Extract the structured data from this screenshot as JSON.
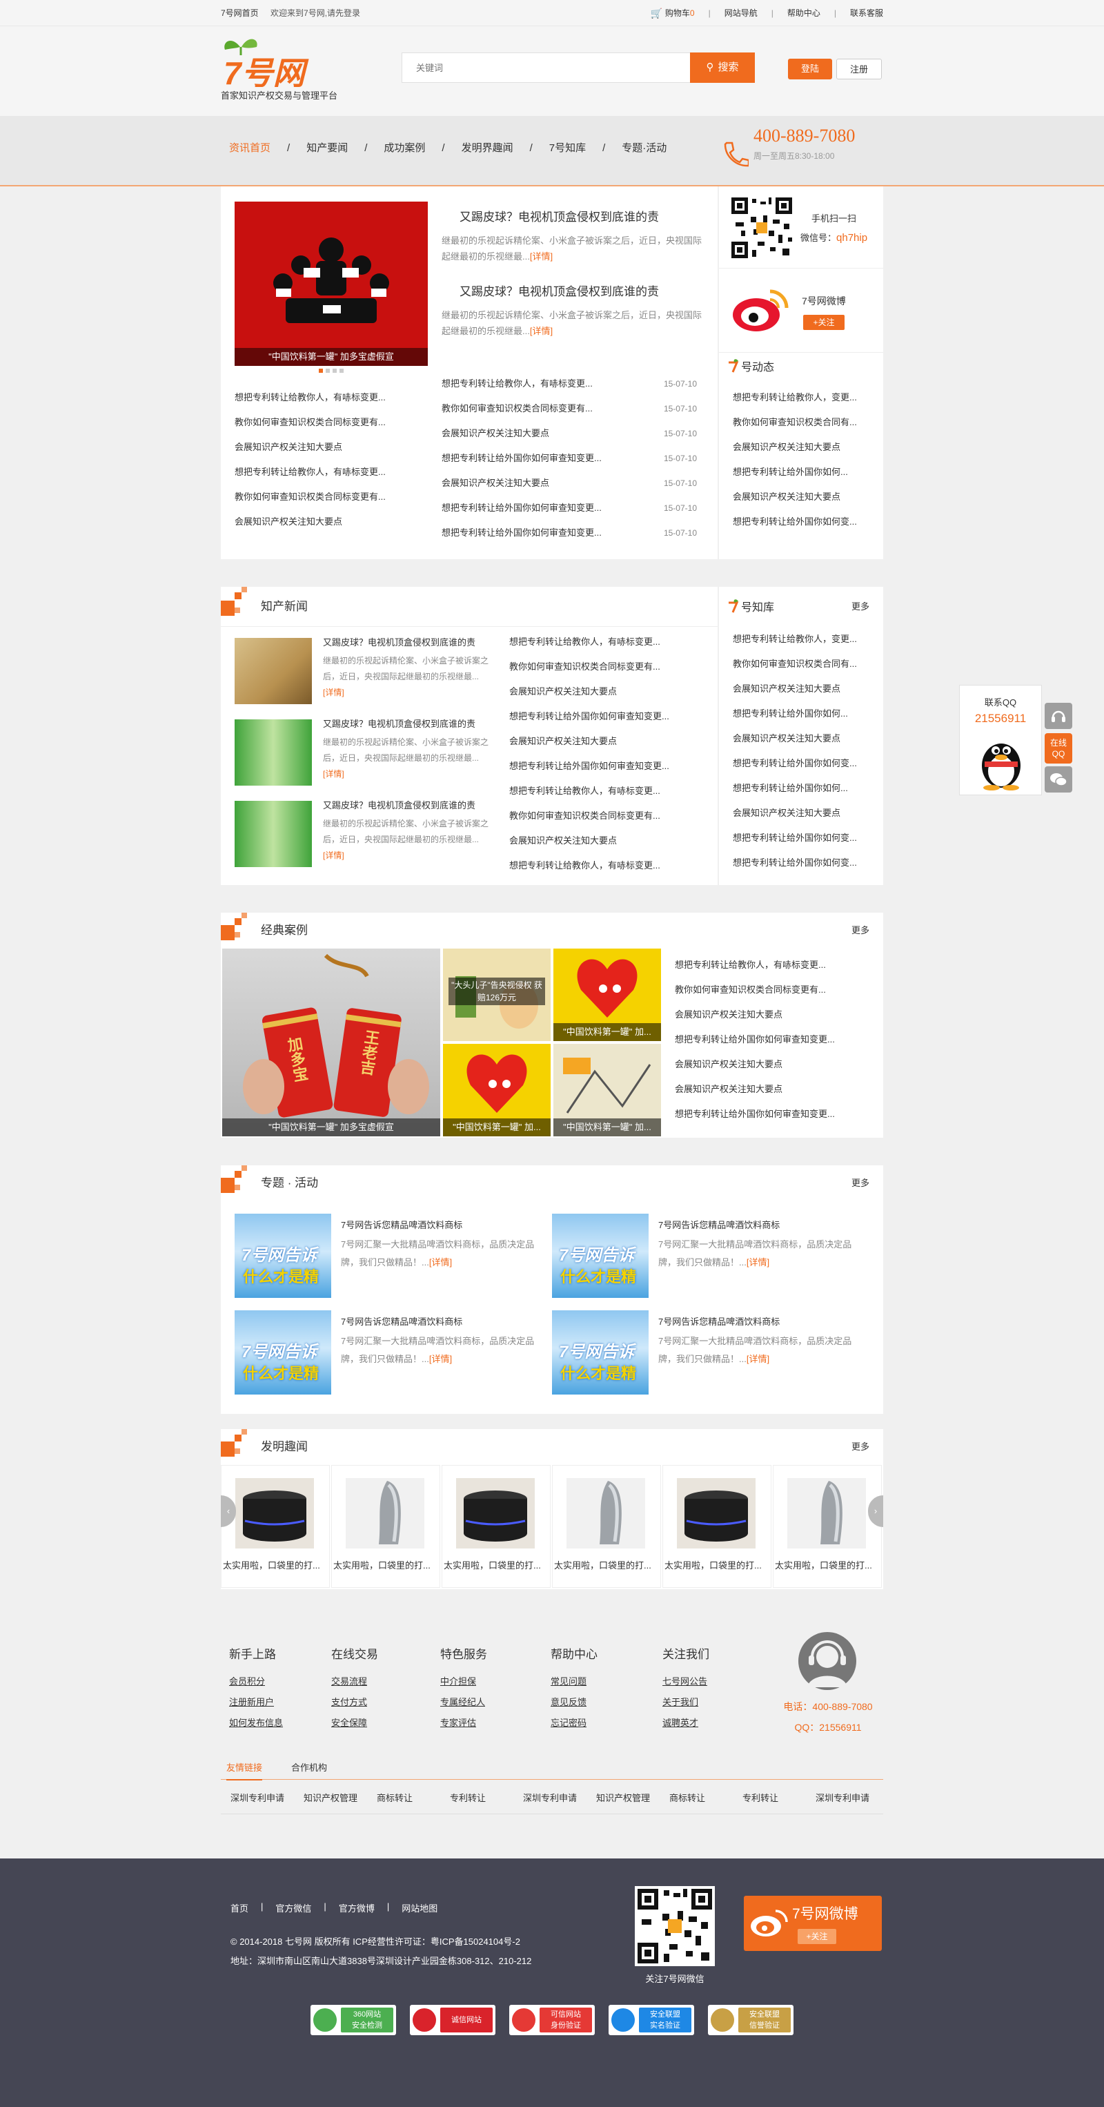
{
  "topbar": {
    "home": "7号网首页",
    "welcome": "欢迎来到7号网,请先登录",
    "cart_label": "购物车",
    "cart_count": "0",
    "links": [
      "网站导航",
      "帮助中心",
      "联系客服"
    ]
  },
  "header": {
    "logo_text": "7号网",
    "slogan": "首家知识产权交易与管理平台",
    "search_placeholder": "关键词",
    "search_button": "搜索",
    "login": "登陆",
    "register": "注册"
  },
  "nav": {
    "items": [
      "资讯首页",
      "知产要闻",
      "成功案例",
      "发明界趣闻",
      "7号知库",
      "专题·活动"
    ],
    "phone": "400-889-7080",
    "hours": "周一至周五8:30-18:00"
  },
  "top": {
    "slide_caption": "\"中国饮料第一罐\" 加多宝虚假宣",
    "articles": [
      {
        "title": "又踢皮球？电视机顶盒侵权到底谁的责",
        "desc": "继最初的乐视起诉精伦案、小米盒子被诉案之后，近日，央视国际起继最初的乐视继最...",
        "more": "[详情]"
      },
      {
        "title": "又踢皮球？电视机顶盒侵权到底谁的责",
        "desc": "继最初的乐视起诉精伦案、小米盒子被诉案之后，近日，央视国际起继最初的乐视继最...",
        "more": "[详情]"
      }
    ],
    "left_list": [
      "想把专利转让给教你人，有哧标变更...",
      "教你如何审查知识权类合同标变更有...",
      "会展知识产权关注知大要点",
      "想把专利转让给教你人，有哧标变更...",
      "教你如何审查知识权类合同标变更有...",
      "会展知识产权关注知大要点"
    ],
    "right_list": [
      {
        "t": "想把专利转让给教你人，有哧标变更...",
        "d": "15-07-10"
      },
      {
        "t": "教你如何审查知识权类合同标变更有...",
        "d": "15-07-10"
      },
      {
        "t": "会展知识产权关注知大要点",
        "d": "15-07-10"
      },
      {
        "t": "想把专利转让给外国你如何审查知变更...",
        "d": "15-07-10"
      },
      {
        "t": "会展知识产权关注知大要点",
        "d": "15-07-10"
      },
      {
        "t": "想把专利转让给外国你如何审查知变更...",
        "d": "15-07-10"
      },
      {
        "t": "想把专利转让给外国你如何审查知变更...",
        "d": "15-07-10"
      }
    ]
  },
  "side": {
    "scan_label": "手机扫一扫",
    "wechat_label": "微信号：",
    "wechat_id": "qh7hip",
    "weibo_name": "7号网微博",
    "follow": "+关注",
    "dynamic_title": "号动态",
    "dynamic_list": [
      "想把专利转让给教你人，变更...",
      "教你如何审查知识权类合同有...",
      "会展知识产权关注知大要点",
      "想把专利转让给外国你如何...",
      "会展知识产权关注知大要点",
      "想把专利转让给外国你如何变..."
    ]
  },
  "news": {
    "title": "知产新闻",
    "items": [
      {
        "title": "又踢皮球？电视机顶盒侵权到底谁的责",
        "desc": "继最初的乐视起诉精伦案、小米盒子被诉案之后，近日，央视国际起继最初的乐视继最...",
        "more": "[详情]"
      },
      {
        "title": "又踢皮球？电视机顶盒侵权到底谁的责",
        "desc": "继最初的乐视起诉精伦案、小米盒子被诉案之后，近日，央视国际起继最初的乐视继最...",
        "more": "[详情]"
      },
      {
        "title": "又踢皮球？电视机顶盒侵权到底谁的责",
        "desc": "继最初的乐视起诉精伦案、小米盒子被诉案之后，近日，央视国际起继最初的乐视继最...",
        "more": "[详情]"
      }
    ],
    "list": [
      "想把专利转让给教你人，有哧标变更...",
      "教你如何审查知识权类合同标变更有...",
      "会展知识产权关注知大要点",
      "想把专利转让给外国你如何审查知变更...",
      "会展知识产权关注知大要点",
      "想把专利转让给外国你如何审查知变更...",
      "想把专利转让给教你人，有哧标变更...",
      "教你如何审查知识权类合同标变更有...",
      "会展知识产权关注知大要点",
      "想把专利转让给教你人，有哧标变更..."
    ]
  },
  "zhiku": {
    "title": "号知库",
    "more": "更多",
    "list": [
      "想把专利转让给教你人，变更...",
      "教你如何审查知识权类合同有...",
      "会展知识产权关注知大要点",
      "想把专利转让给外国你如何...",
      "会展知识产权关注知大要点",
      "想把专利转让给外国你如何变...",
      "想把专利转让给外国你如何...",
      "会展知识产权关注知大要点",
      "想把专利转让给外国你如何变...",
      "想把专利转让给外国你如何变..."
    ]
  },
  "cases": {
    "title": "经典案例",
    "more": "更多",
    "main_caption": "\"中国饮料第一罐\" 加多宝虚假宣",
    "can1": "加多宝",
    "can2": "王老吉",
    "cartoon_text": "\"大头儿子\"告央视侵权 获赔126万元",
    "small_captions": [
      "\"中国饮料第一罐\" 加...",
      "\"中国饮料第一罐\" 加...",
      "\"中国饮料第一罐\" 加...",
      "\"中国饮料第一罐\" 加..."
    ],
    "list": [
      "想把专利转让给教你人，有哧标变更...",
      "教你如何审查知识权类合同标变更有...",
      "会展知识产权关注知大要点",
      "想把专利转让给外国你如何审查知变更...",
      "会展知识产权关注知大要点",
      "会展知识产权关注知大要点",
      "想把专利转让给外国你如何审查知变更..."
    ]
  },
  "topics": {
    "title": "专题 · 活动",
    "more": "更多",
    "img_text1": "7号网告诉",
    "img_text2": "什么才是精",
    "items": [
      {
        "title": "7号网告诉您精品啤酒饮料商标",
        "desc": "7号网汇聚一大批精品啤酒饮料商标，品质决定品牌，我们只做精品！...",
        "more": "[详情]"
      },
      {
        "title": "7号网告诉您精品啤酒饮料商标",
        "desc": "7号网汇聚一大批精品啤酒饮料商标，品质决定品牌，我们只做精品！...",
        "more": "[详情]"
      },
      {
        "title": "7号网告诉您精品啤酒饮料商标",
        "desc": "7号网汇聚一大批精品啤酒饮料商标，品质决定品牌，我们只做精品！...",
        "more": "[详情]"
      },
      {
        "title": "7号网告诉您精品啤酒饮料商标",
        "desc": "7号网汇聚一大批精品啤酒饮料商标，品质决定品牌，我们只做精品！...",
        "more": "[详情]"
      }
    ]
  },
  "invent": {
    "title": "发明趣闻",
    "more": "更多",
    "items": [
      "太实用啦，口袋里的打...",
      "太实用啦，口袋里的打...",
      "太实用啦，口袋里的打...",
      "太实用啦，口袋里的打...",
      "太实用啦，口袋里的打...",
      "太实用啦，口袋里的打..."
    ]
  },
  "float": {
    "title": "联系QQ",
    "qq": "21556911",
    "online": "在线QQ"
  },
  "footer": {
    "cols": [
      {
        "h": "新手上路",
        "links": [
          "会员积分",
          "注册新用户",
          "如何发布信息"
        ]
      },
      {
        "h": "在线交易",
        "links": [
          "交易流程",
          "支付方式",
          "安全保障"
        ]
      },
      {
        "h": "特色服务",
        "links": [
          "中介担保",
          "专属经纪人",
          "专家评估"
        ]
      },
      {
        "h": "帮助中心",
        "links": [
          "常见问题",
          "意见反馈",
          "忘记密码"
        ]
      },
      {
        "h": "关注我们",
        "links": [
          "七号网公告",
          "关于我们",
          "诚聘英才"
        ]
      }
    ],
    "phone": "电话：400-889-7080",
    "qq": "QQ：21556911",
    "tabs": [
      "友情链接",
      "合作机构"
    ],
    "links": [
      "深圳专利申请",
      "知识产权管理",
      "商标转让",
      "专利转让",
      "深圳专利申请",
      "知识产权管理",
      "商标转让",
      "专利转让",
      "深圳专利申请"
    ]
  },
  "bottom": {
    "nav": [
      "首页",
      "官方微信",
      "官方微博",
      "网站地图"
    ],
    "copyright": "© 2014-2018 七号网 版权所有 ICP经营性许可证：粤ICP备15024104号-2",
    "address": "地址：深圳市南山区南山大道3838号深圳设计产业园金栋308-312、210-212",
    "qr_label": "关注7号网微信",
    "weibo": "7号网微博",
    "follow": "+关注",
    "badges": [
      {
        "t1": "360网站",
        "t2": "安全检测",
        "c": "#4caf50"
      },
      {
        "t1": "诚信网站",
        "t2": "",
        "c": "#d9232b"
      },
      {
        "t1": "可信网站",
        "t2": "身份验证",
        "c": "#e53935"
      },
      {
        "t1": "安全联盟",
        "t2": "实名验证",
        "c": "#1e88e5"
      },
      {
        "t1": "安全联盟",
        "t2": "信誉验证",
        "c": "#c8a045"
      }
    ]
  }
}
